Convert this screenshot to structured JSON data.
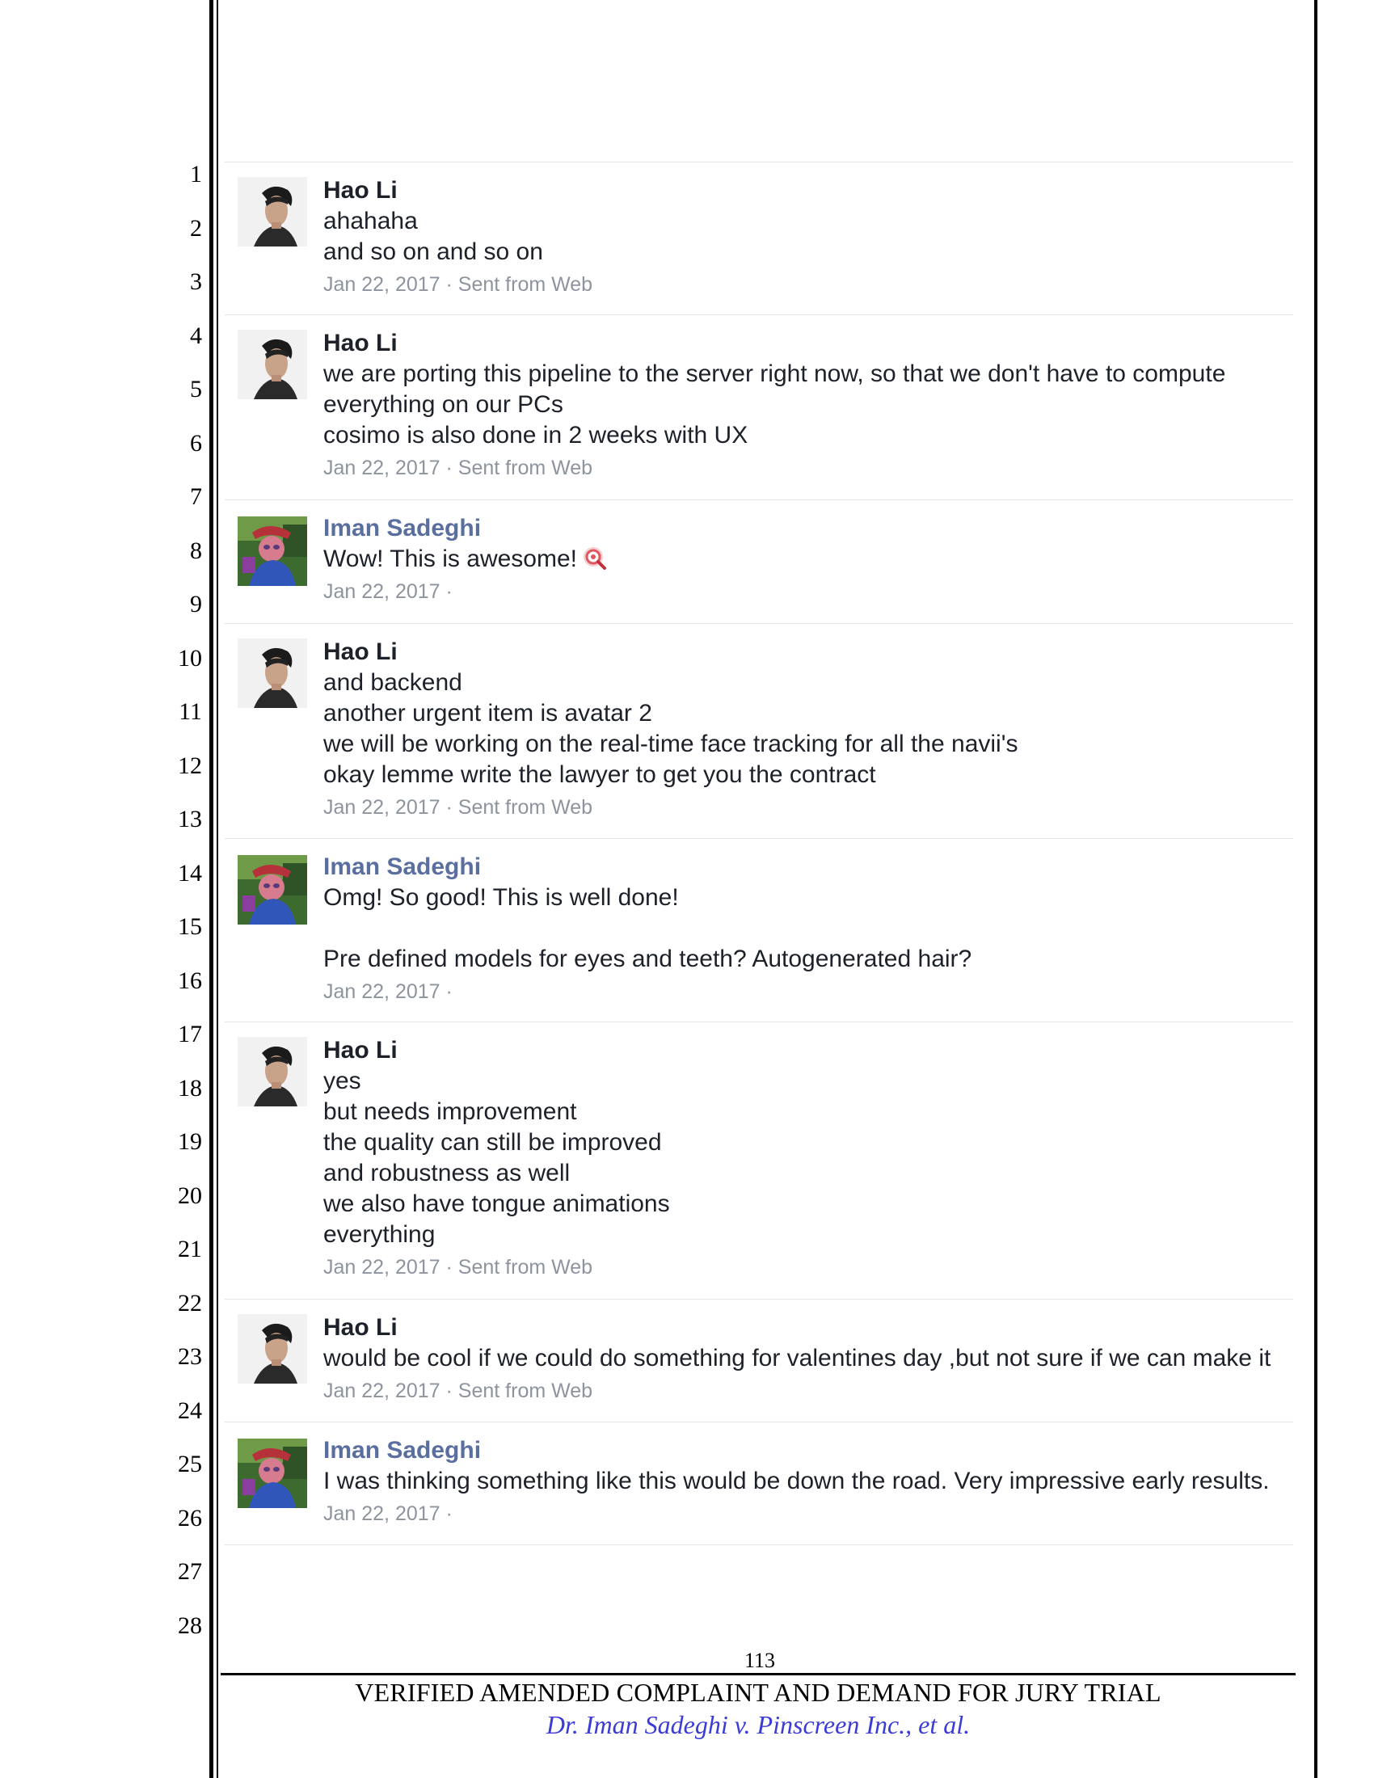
{
  "line_numbers": [
    "1",
    "2",
    "3",
    "4",
    "5",
    "6",
    "7",
    "8",
    "9",
    "10",
    "11",
    "12",
    "13",
    "14",
    "15",
    "16",
    "17",
    "18",
    "19",
    "20",
    "21",
    "22",
    "23",
    "24",
    "25",
    "26",
    "27",
    "28"
  ],
  "messages": [
    {
      "sender": "Hao Li",
      "lines": [
        "ahahaha",
        "and so on and so on"
      ],
      "date": "Jan 22, 2017",
      "source": "Sent from Web"
    },
    {
      "sender": "Hao Li",
      "lines": [
        "we are porting this pipeline to the server right now, so that we don't have to compute",
        "everything on our PCs",
        "cosimo is also done in 2 weeks with UX"
      ],
      "date": "Jan 22, 2017",
      "source": "Sent from Web"
    },
    {
      "sender": "Iman Sadeghi",
      "lines": [
        "Wow! This is awesome!"
      ],
      "date": "Jan 22, 2017",
      "source": "",
      "emoji": "pin-emoji-icon"
    },
    {
      "sender": "Hao Li",
      "lines": [
        "and backend",
        "another urgent item is avatar 2",
        "we will be working on the real-time face tracking for all the navii's",
        "okay lemme write the lawyer to get you the contract"
      ],
      "date": "Jan 22, 2017",
      "source": "Sent from Web"
    },
    {
      "sender": "Iman Sadeghi",
      "lines": [
        "Omg! So good! This is well done!",
        "",
        "Pre defined models for eyes and teeth? Autogenerated hair?"
      ],
      "date": "Jan 22, 2017",
      "source": ""
    },
    {
      "sender": "Hao Li",
      "lines": [
        "yes",
        "but needs improvement",
        "the quality can still be improved",
        "and robustness as well",
        "we also have tongue animations",
        "everything"
      ],
      "date": "Jan 22, 2017",
      "source": "Sent from Web"
    },
    {
      "sender": "Hao Li",
      "lines": [
        "would be cool if we could do something for valentines day ,but not sure if we can make it"
      ],
      "date": "Jan 22, 2017",
      "source": "Sent from Web"
    },
    {
      "sender": "Iman Sadeghi",
      "lines": [
        "I was thinking something like this would be down the road. Very impressive early results."
      ],
      "date": "Jan 22, 2017",
      "source": ""
    }
  ],
  "meta_separator": " · ",
  "footer": {
    "page_number": "113",
    "title": "VERIFIED AMENDED COMPLAINT AND DEMAND FOR JURY TRIAL",
    "caption": "Dr. Iman Sadeghi v. Pinscreen Inc., et al."
  },
  "colors": {
    "sender_hao": "#1d2129",
    "sender_iman": "#5a6fa0",
    "meta": "#8d949e",
    "divider": "#e4e6ea",
    "caption": "#3b3bd6"
  }
}
